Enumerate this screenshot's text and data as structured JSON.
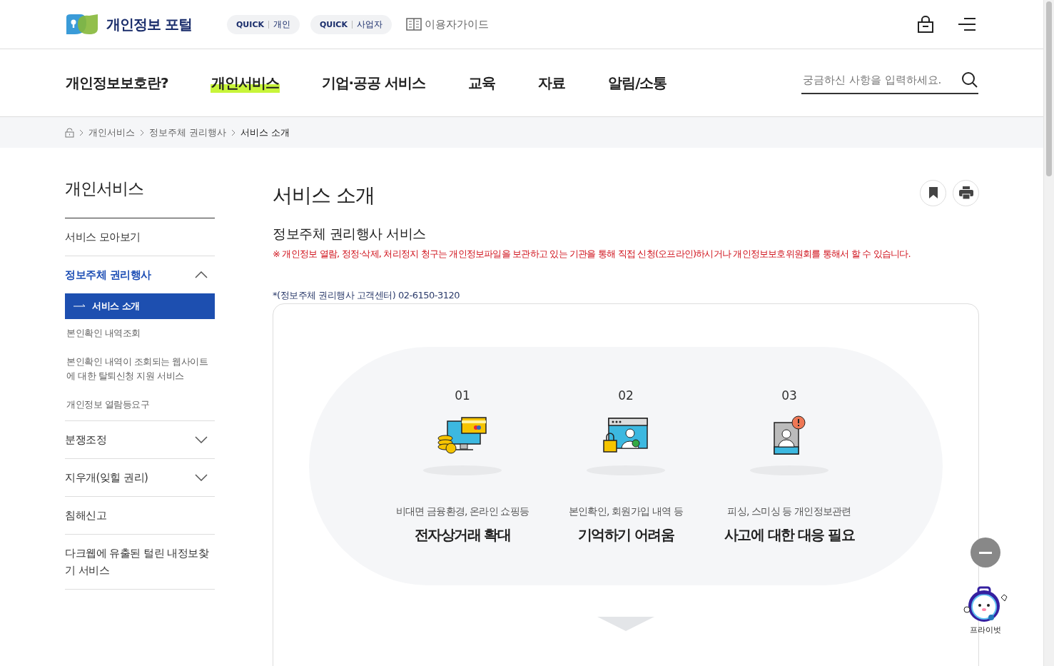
{
  "header": {
    "logo_text": "개인정보 포털",
    "quick_links": [
      {
        "tag": "QUICK",
        "label": "개인"
      },
      {
        "tag": "QUICK",
        "label": "사업자"
      }
    ],
    "guide_link": "이용자가이드"
  },
  "nav": {
    "items": [
      {
        "label": "개인정보보호란?",
        "selected": false
      },
      {
        "label": "개인서비스",
        "selected": true
      },
      {
        "label": "기업·공공 서비스",
        "selected": false
      },
      {
        "label": "교육",
        "selected": false
      },
      {
        "label": "자료",
        "selected": false
      },
      {
        "label": "알림/소통",
        "selected": false
      }
    ],
    "search": {
      "placeholder": "궁금하신 사항을 입력하세요."
    }
  },
  "breadcrumb": [
    "개인서비스",
    "정보주체 권리행사",
    "서비스 소개"
  ],
  "sidebar": {
    "title": "개인서비스",
    "items": [
      {
        "label": "서비스 모아보기",
        "selected": false
      },
      {
        "label": "정보주체 권리행사",
        "selected": true,
        "expanded": true,
        "children": [
          {
            "label": "서비스 소개",
            "selected": true
          },
          {
            "label": "본인확인 내역조회",
            "selected": false
          },
          {
            "label": "본인확인 내역이 조회되는 웹사이트에 대한 탈퇴신청 지원 서비스",
            "selected": false
          },
          {
            "label": "개인정보 열람등요구",
            "selected": false
          }
        ]
      },
      {
        "label": "분쟁조정",
        "selected": false,
        "expanded": false
      },
      {
        "label": "지우개(잊힐 권리)",
        "selected": false,
        "expanded": false
      },
      {
        "label": "침해신고",
        "selected": false
      },
      {
        "label": "다크웹에 유출된 털린 내정보찾기 서비스",
        "selected": false
      }
    ]
  },
  "main": {
    "title": "서비스 소개",
    "section_title": "정보주체 권리행사 서비스",
    "notice": "※ 개인정보 열람, 정정·삭제, 처리정지 청구는 개인정보파일을 보관하고 있는 기관을 통해 직접 신청(오프라인)하시거나 개인정보보호위원회를 통해서 할 수 있습니다.",
    "contact": "*(정보주체 권리행사 고객센터) 02-6150-3120",
    "steps": [
      {
        "number": "01",
        "kind": "shopping",
        "caption": "비대면 금융환경, 온라인 쇼핑등",
        "headline": "전자상거래 확대"
      },
      {
        "number": "02",
        "kind": "account",
        "caption": "본인확인, 회원가입 내역 등",
        "headline": "기억하기 어려움"
      },
      {
        "number": "03",
        "kind": "alert",
        "caption": "피싱, 스미싱 등 개인정보관련",
        "headline": "사고에 대한 대응 필요"
      }
    ]
  },
  "chatbot": {
    "label": "프라이벗"
  }
}
